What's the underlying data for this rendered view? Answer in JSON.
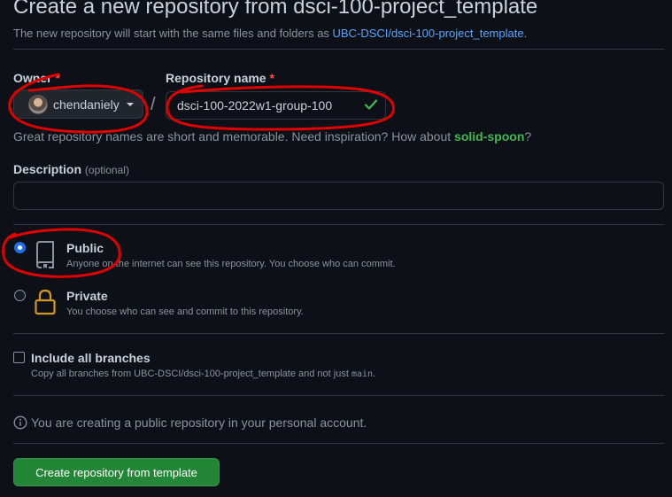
{
  "header": {
    "title": "Create a new repository from dsci-100-project_template",
    "subtitle_prefix": "The new repository will start with the same files and folders as ",
    "template_link": "UBC-DSCI/dsci-100-project_template",
    "subtitle_suffix": "."
  },
  "owner": {
    "label": "Owner",
    "required_mark": "*",
    "value": "chendaniely",
    "icon": "avatar"
  },
  "separator": "/",
  "repo_name": {
    "label": "Repository name",
    "required_mark": "*",
    "value": "dsci-100-2022w1-group-100",
    "status_icon": "check-icon",
    "status_color": "#3fb950"
  },
  "hint": {
    "text": "Great repository names are short and memorable. Need inspiration? How about ",
    "suggestion": "solid-spoon",
    "suffix": "?"
  },
  "description": {
    "label": "Description",
    "optional": "(optional)",
    "value": ""
  },
  "visibility": {
    "public": {
      "title": "Public",
      "desc": "Anyone on the internet can see this repository. You choose who can commit.",
      "selected": true,
      "icon": "repo-icon"
    },
    "private": {
      "title": "Private",
      "desc": "You choose who can see and commit to this repository.",
      "selected": false,
      "icon": "lock-icon"
    }
  },
  "branches": {
    "label": "Include all branches",
    "desc_prefix": "Copy all branches from UBC-DSCI/dsci-100-project_template and not just ",
    "branch": "main",
    "desc_suffix": ".",
    "checked": false
  },
  "info": {
    "icon": "info-icon",
    "text": "You are creating a public repository in your personal account."
  },
  "submit": {
    "label": "Create repository from template"
  },
  "colors": {
    "accent": "#58a6ff",
    "primary_button": "#238636",
    "required": "#f85149",
    "annotation": "#e00000"
  }
}
